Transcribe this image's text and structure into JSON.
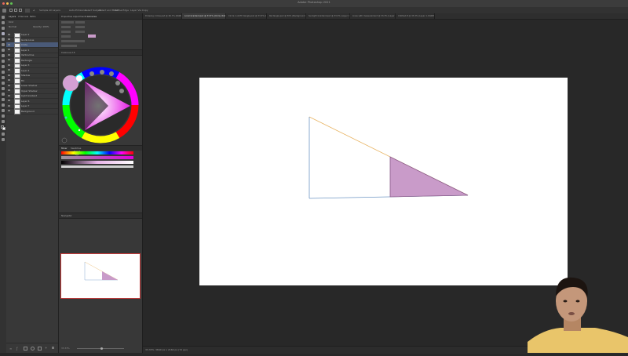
{
  "window": {
    "title": "Adobe Photoshop 2021"
  },
  "options_bar": {
    "items": [
      "Sample All Layers",
      "Auto-Enhance",
      "Select Subject",
      "Select and Mask...",
      "Refine Edge",
      "Layer Via Copy"
    ]
  },
  "document_tabs": [
    {
      "label": "Drawing circles.psd @ 66.7% (RGB/8)",
      "active": false
    },
    {
      "label": "Local Gradient.psd @ 33.3% (Circle, RGB/8)",
      "active": true
    },
    {
      "label": "Circle in shift triangle.psd @ 33.3% (RGB/8)",
      "active": false
    },
    {
      "label": "Rectangle.psd @ 50% (Background, RGB/8)",
      "active": false
    },
    {
      "label": "Sunlight Gradient.psd @ 33.3% (Layer 1, RGB/8)",
      "active": false
    },
    {
      "label": "Lines with measurement @ 33.3% (Layer 1, RGB/8)",
      "active": false
    },
    {
      "label": "Untitled-8 @ 33.3% (Layer 1, RGB/8)",
      "active": false
    }
  ],
  "layers_panel": {
    "tabs": [
      "Layers",
      "Channels",
      "Paths"
    ],
    "kind_label": "Kind",
    "blend_mode": "Normal",
    "opacity_label": "Opacity: 100%",
    "layers": [
      {
        "name": "Layer 2",
        "selected": false
      },
      {
        "name": "Guide Lines",
        "selected": false
      },
      {
        "name": "Circle",
        "selected": true
      },
      {
        "name": "Layer 1",
        "selected": false
      },
      {
        "name": "Vertical line",
        "selected": false
      },
      {
        "name": "Rectangle",
        "selected": false
      },
      {
        "name": "Layer 3",
        "selected": false
      },
      {
        "name": "Layer 4",
        "selected": false
      },
      {
        "name": "Shadow",
        "selected": false
      },
      {
        "name": "Fill",
        "selected": false
      },
      {
        "name": "Lower Shadow",
        "selected": false
      },
      {
        "name": "Upper Shadow",
        "selected": false
      },
      {
        "name": "Light Gradient",
        "selected": false
      },
      {
        "name": "Layer 6",
        "selected": false
      },
      {
        "name": "Layer 7",
        "selected": false
      },
      {
        "name": "Background",
        "selected": false
      }
    ]
  },
  "properties_panel": {
    "tabs": [
      "Properties",
      "Adjustments",
      "Libraries"
    ]
  },
  "color_panel": {
    "title": "Coolorus 2.5",
    "foreground_color": "#d4a0d4",
    "background_color": "#ffffff",
    "hue_color": "#e000e0",
    "tabs": [
      "Mixer",
      "Swatches"
    ]
  },
  "navigator_panel": {
    "title": "Navigator"
  },
  "status_bar": {
    "zoom": "33.33%",
    "info": "3840 px x 2160 px (72 ppi)"
  },
  "accents": {
    "triangle_fill": "#c99bc9",
    "triangle_stroke": "#8a5c8a",
    "guide_orange": "#e8b463",
    "guide_blue": "#6e96c4"
  }
}
